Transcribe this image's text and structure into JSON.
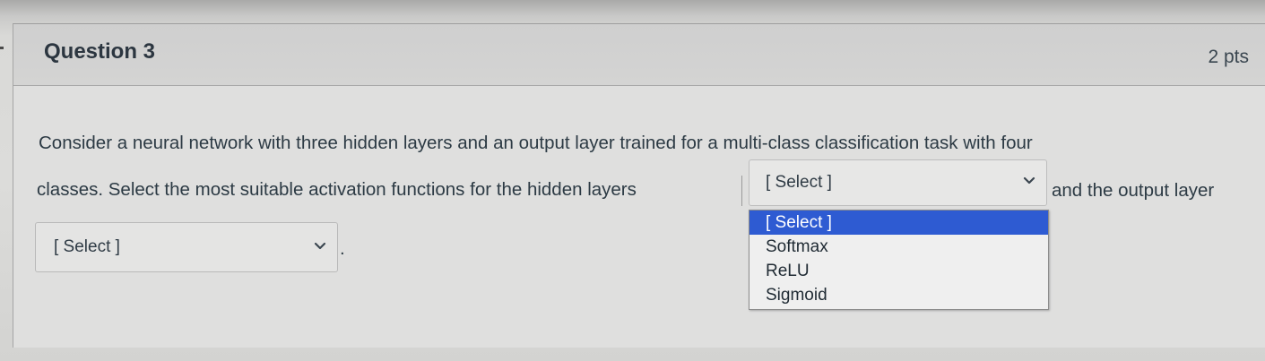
{
  "question": {
    "title": "Question 3",
    "points": "2 pts"
  },
  "body": {
    "line1": "Consider a neural network with three hidden layers and an output layer trained for a multi-class classification task with four",
    "line2_prefix": "classes. Select the most suitable activation functions for the hidden layers",
    "line2_suffix": "and the output layer",
    "period": "."
  },
  "hidden_select": {
    "selected": "[ Select ]",
    "icon": "chevron-down-icon"
  },
  "output_select": {
    "selected": "[ Select ]",
    "icon": "chevron-down-icon"
  },
  "dropdown": {
    "options": [
      {
        "label": "[ Select ]",
        "selected": true
      },
      {
        "label": "Softmax",
        "selected": false
      },
      {
        "label": "ReLU",
        "selected": false
      },
      {
        "label": "Sigmoid",
        "selected": false
      }
    ],
    "highlight_color": "#2e5bd2"
  }
}
